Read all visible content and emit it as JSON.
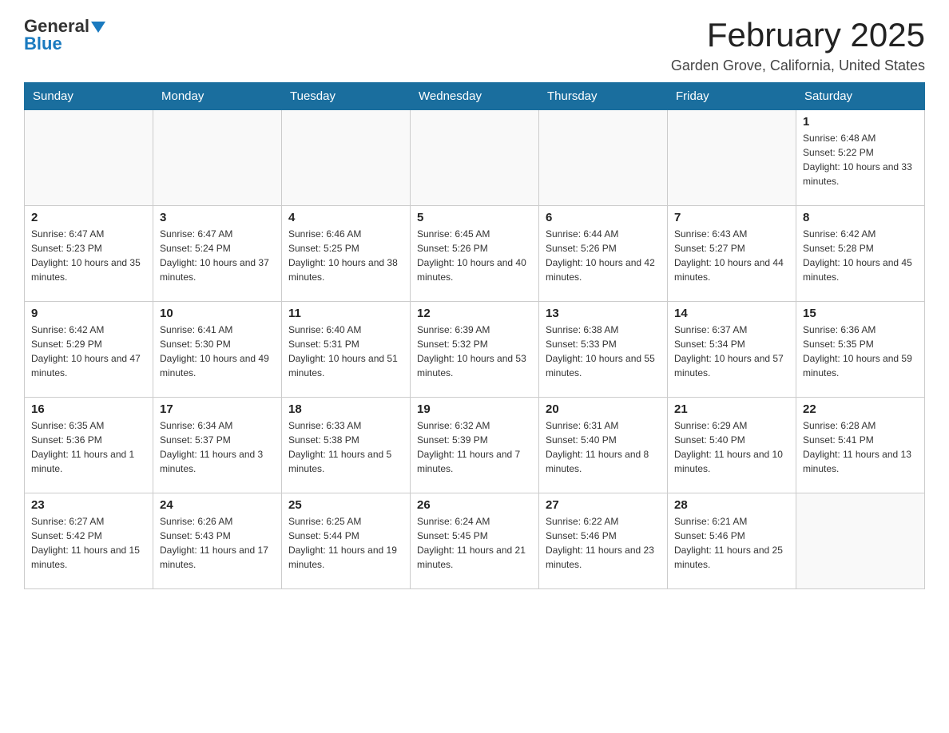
{
  "logo": {
    "general": "General",
    "blue": "Blue"
  },
  "header": {
    "title": "February 2025",
    "location": "Garden Grove, California, United States"
  },
  "days_of_week": [
    "Sunday",
    "Monday",
    "Tuesday",
    "Wednesday",
    "Thursday",
    "Friday",
    "Saturday"
  ],
  "weeks": [
    [
      {
        "day": "",
        "info": ""
      },
      {
        "day": "",
        "info": ""
      },
      {
        "day": "",
        "info": ""
      },
      {
        "day": "",
        "info": ""
      },
      {
        "day": "",
        "info": ""
      },
      {
        "day": "",
        "info": ""
      },
      {
        "day": "1",
        "info": "Sunrise: 6:48 AM\nSunset: 5:22 PM\nDaylight: 10 hours and 33 minutes."
      }
    ],
    [
      {
        "day": "2",
        "info": "Sunrise: 6:47 AM\nSunset: 5:23 PM\nDaylight: 10 hours and 35 minutes."
      },
      {
        "day": "3",
        "info": "Sunrise: 6:47 AM\nSunset: 5:24 PM\nDaylight: 10 hours and 37 minutes."
      },
      {
        "day": "4",
        "info": "Sunrise: 6:46 AM\nSunset: 5:25 PM\nDaylight: 10 hours and 38 minutes."
      },
      {
        "day": "5",
        "info": "Sunrise: 6:45 AM\nSunset: 5:26 PM\nDaylight: 10 hours and 40 minutes."
      },
      {
        "day": "6",
        "info": "Sunrise: 6:44 AM\nSunset: 5:26 PM\nDaylight: 10 hours and 42 minutes."
      },
      {
        "day": "7",
        "info": "Sunrise: 6:43 AM\nSunset: 5:27 PM\nDaylight: 10 hours and 44 minutes."
      },
      {
        "day": "8",
        "info": "Sunrise: 6:42 AM\nSunset: 5:28 PM\nDaylight: 10 hours and 45 minutes."
      }
    ],
    [
      {
        "day": "9",
        "info": "Sunrise: 6:42 AM\nSunset: 5:29 PM\nDaylight: 10 hours and 47 minutes."
      },
      {
        "day": "10",
        "info": "Sunrise: 6:41 AM\nSunset: 5:30 PM\nDaylight: 10 hours and 49 minutes."
      },
      {
        "day": "11",
        "info": "Sunrise: 6:40 AM\nSunset: 5:31 PM\nDaylight: 10 hours and 51 minutes."
      },
      {
        "day": "12",
        "info": "Sunrise: 6:39 AM\nSunset: 5:32 PM\nDaylight: 10 hours and 53 minutes."
      },
      {
        "day": "13",
        "info": "Sunrise: 6:38 AM\nSunset: 5:33 PM\nDaylight: 10 hours and 55 minutes."
      },
      {
        "day": "14",
        "info": "Sunrise: 6:37 AM\nSunset: 5:34 PM\nDaylight: 10 hours and 57 minutes."
      },
      {
        "day": "15",
        "info": "Sunrise: 6:36 AM\nSunset: 5:35 PM\nDaylight: 10 hours and 59 minutes."
      }
    ],
    [
      {
        "day": "16",
        "info": "Sunrise: 6:35 AM\nSunset: 5:36 PM\nDaylight: 11 hours and 1 minute."
      },
      {
        "day": "17",
        "info": "Sunrise: 6:34 AM\nSunset: 5:37 PM\nDaylight: 11 hours and 3 minutes."
      },
      {
        "day": "18",
        "info": "Sunrise: 6:33 AM\nSunset: 5:38 PM\nDaylight: 11 hours and 5 minutes."
      },
      {
        "day": "19",
        "info": "Sunrise: 6:32 AM\nSunset: 5:39 PM\nDaylight: 11 hours and 7 minutes."
      },
      {
        "day": "20",
        "info": "Sunrise: 6:31 AM\nSunset: 5:40 PM\nDaylight: 11 hours and 8 minutes."
      },
      {
        "day": "21",
        "info": "Sunrise: 6:29 AM\nSunset: 5:40 PM\nDaylight: 11 hours and 10 minutes."
      },
      {
        "day": "22",
        "info": "Sunrise: 6:28 AM\nSunset: 5:41 PM\nDaylight: 11 hours and 13 minutes."
      }
    ],
    [
      {
        "day": "23",
        "info": "Sunrise: 6:27 AM\nSunset: 5:42 PM\nDaylight: 11 hours and 15 minutes."
      },
      {
        "day": "24",
        "info": "Sunrise: 6:26 AM\nSunset: 5:43 PM\nDaylight: 11 hours and 17 minutes."
      },
      {
        "day": "25",
        "info": "Sunrise: 6:25 AM\nSunset: 5:44 PM\nDaylight: 11 hours and 19 minutes."
      },
      {
        "day": "26",
        "info": "Sunrise: 6:24 AM\nSunset: 5:45 PM\nDaylight: 11 hours and 21 minutes."
      },
      {
        "day": "27",
        "info": "Sunrise: 6:22 AM\nSunset: 5:46 PM\nDaylight: 11 hours and 23 minutes."
      },
      {
        "day": "28",
        "info": "Sunrise: 6:21 AM\nSunset: 5:46 PM\nDaylight: 11 hours and 25 minutes."
      },
      {
        "day": "",
        "info": ""
      }
    ]
  ]
}
